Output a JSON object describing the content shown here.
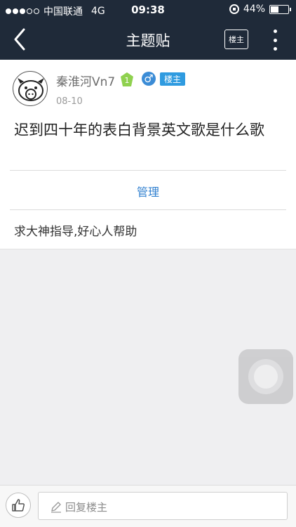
{
  "status_bar": {
    "carrier": "中国联通",
    "network": "4G",
    "time": "09:38",
    "battery_text": "44%",
    "battery_level": 0.44,
    "signal_bars_filled": 3,
    "signal_bars_total": 5
  },
  "nav": {
    "title": "主题贴",
    "op_only_label": "楼主"
  },
  "post": {
    "username": "秦淮河Vn7",
    "level": "1",
    "gender_symbol": "♂",
    "host_badge": "楼主",
    "date": "08-10",
    "title": "迟到四十年的表白背景英文歌是什么歌",
    "manage_label": "管理",
    "body": "求大神指导,好心人帮助"
  },
  "footer": {
    "reply_placeholder": "回复楼主"
  },
  "colors": {
    "topbar_bg": "#1f2a39",
    "page_bg": "#efeff1",
    "link_blue": "#2f7fcf",
    "host_badge_blue": "#2f9be0",
    "level_green": "#8fd14f"
  }
}
